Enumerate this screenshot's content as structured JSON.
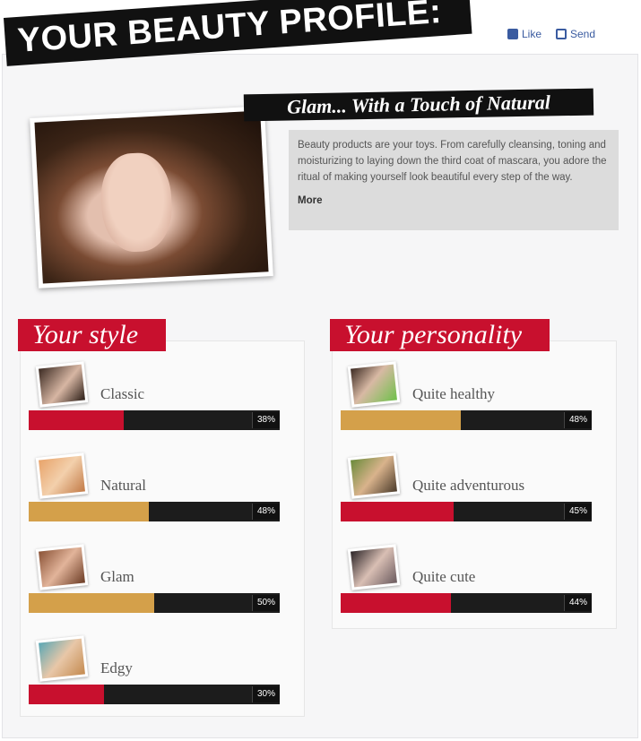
{
  "header": {
    "title": "YOUR BEAUTY PROFILE:",
    "like_label": "Like",
    "send_label": "Send"
  },
  "profile": {
    "tagline": "Glam... With a Touch of Natural",
    "description": "Beauty products are your toys. From carefully cleansing, toning and moisturizing to laying down the third coat of mascara, you adore the ritual of making yourself look beautiful every step of the way.",
    "more_label": "More"
  },
  "style_section": {
    "title": "Your style",
    "traits": [
      {
        "label": "Classic",
        "value": 0.38,
        "color": "#c8102e",
        "pct": "38%"
      },
      {
        "label": "Natural",
        "value": 0.48,
        "color": "#d4a04a",
        "pct": "48%"
      },
      {
        "label": "Glam",
        "value": 0.5,
        "color": "#d4a04a",
        "pct": "50%"
      },
      {
        "label": "Edgy",
        "value": 0.3,
        "color": "#c8102e",
        "pct": "30%"
      }
    ]
  },
  "personality_section": {
    "title": "Your personality",
    "traits": [
      {
        "label": "Quite healthy",
        "value": 0.48,
        "color": "#d4a04a",
        "pct": "48%"
      },
      {
        "label": "Quite adventurous",
        "value": 0.45,
        "color": "#c8102e",
        "pct": "45%"
      },
      {
        "label": "Quite cute",
        "value": 0.44,
        "color": "#c8102e",
        "pct": "44%"
      }
    ]
  },
  "icons": {
    "like": "facebook-like-icon",
    "send": "send-icon"
  }
}
